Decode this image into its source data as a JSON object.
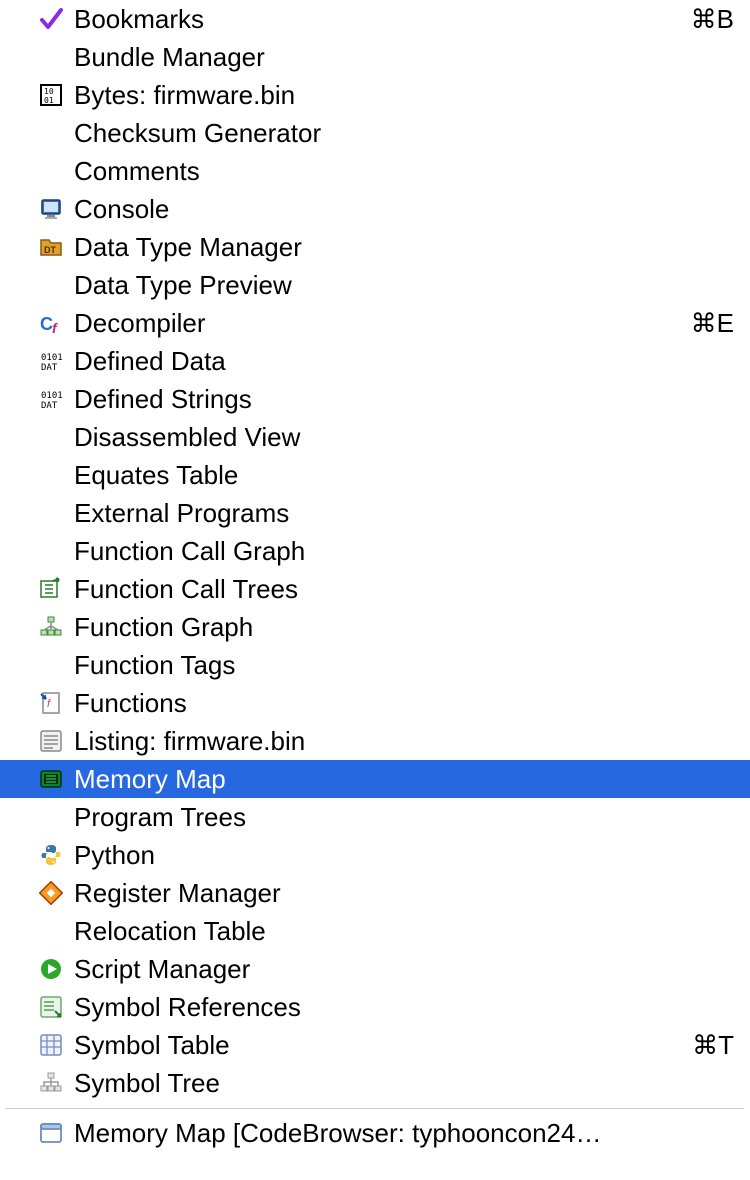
{
  "menu": {
    "items": [
      {
        "icon": "check",
        "label": "Bookmarks",
        "shortcut": "⌘B"
      },
      {
        "icon": "",
        "label": "Bundle Manager",
        "shortcut": ""
      },
      {
        "icon": "bytes",
        "label": "Bytes: firmware.bin",
        "shortcut": ""
      },
      {
        "icon": "",
        "label": "Checksum Generator",
        "shortcut": ""
      },
      {
        "icon": "",
        "label": "Comments",
        "shortcut": ""
      },
      {
        "icon": "console",
        "label": "Console",
        "shortcut": ""
      },
      {
        "icon": "dtmgr",
        "label": "Data Type Manager",
        "shortcut": ""
      },
      {
        "icon": "",
        "label": "Data Type Preview",
        "shortcut": ""
      },
      {
        "icon": "cf",
        "label": "Decompiler",
        "shortcut": "⌘E"
      },
      {
        "icon": "dat",
        "label": "Defined Data",
        "shortcut": ""
      },
      {
        "icon": "dat",
        "label": "Defined Strings",
        "shortcut": ""
      },
      {
        "icon": "",
        "label": "Disassembled View",
        "shortcut": ""
      },
      {
        "icon": "",
        "label": "Equates Table",
        "shortcut": ""
      },
      {
        "icon": "",
        "label": "External Programs",
        "shortcut": ""
      },
      {
        "icon": "",
        "label": "Function Call Graph",
        "shortcut": ""
      },
      {
        "icon": "fctree",
        "label": "Function Call Trees",
        "shortcut": ""
      },
      {
        "icon": "fgraph",
        "label": "Function Graph",
        "shortcut": ""
      },
      {
        "icon": "",
        "label": "Function Tags",
        "shortcut": ""
      },
      {
        "icon": "functions",
        "label": "Functions",
        "shortcut": ""
      },
      {
        "icon": "listing",
        "label": "Listing:  firmware.bin",
        "shortcut": ""
      },
      {
        "icon": "memmap",
        "label": "Memory Map",
        "shortcut": "",
        "selected": true
      },
      {
        "icon": "",
        "label": "Program Trees",
        "shortcut": ""
      },
      {
        "icon": "python",
        "label": "Python",
        "shortcut": ""
      },
      {
        "icon": "register",
        "label": "Register Manager",
        "shortcut": ""
      },
      {
        "icon": "",
        "label": "Relocation Table",
        "shortcut": ""
      },
      {
        "icon": "play",
        "label": "Script Manager",
        "shortcut": ""
      },
      {
        "icon": "symref",
        "label": "Symbol References",
        "shortcut": ""
      },
      {
        "icon": "symtbl",
        "label": "Symbol Table",
        "shortcut": "⌘T"
      },
      {
        "icon": "symtree",
        "label": "Symbol Tree",
        "shortcut": ""
      }
    ]
  },
  "footer": {
    "icon": "window",
    "label": "Memory Map [CodeBrowser: typhooncon24…"
  },
  "colors": {
    "selection": "#2568e0"
  }
}
